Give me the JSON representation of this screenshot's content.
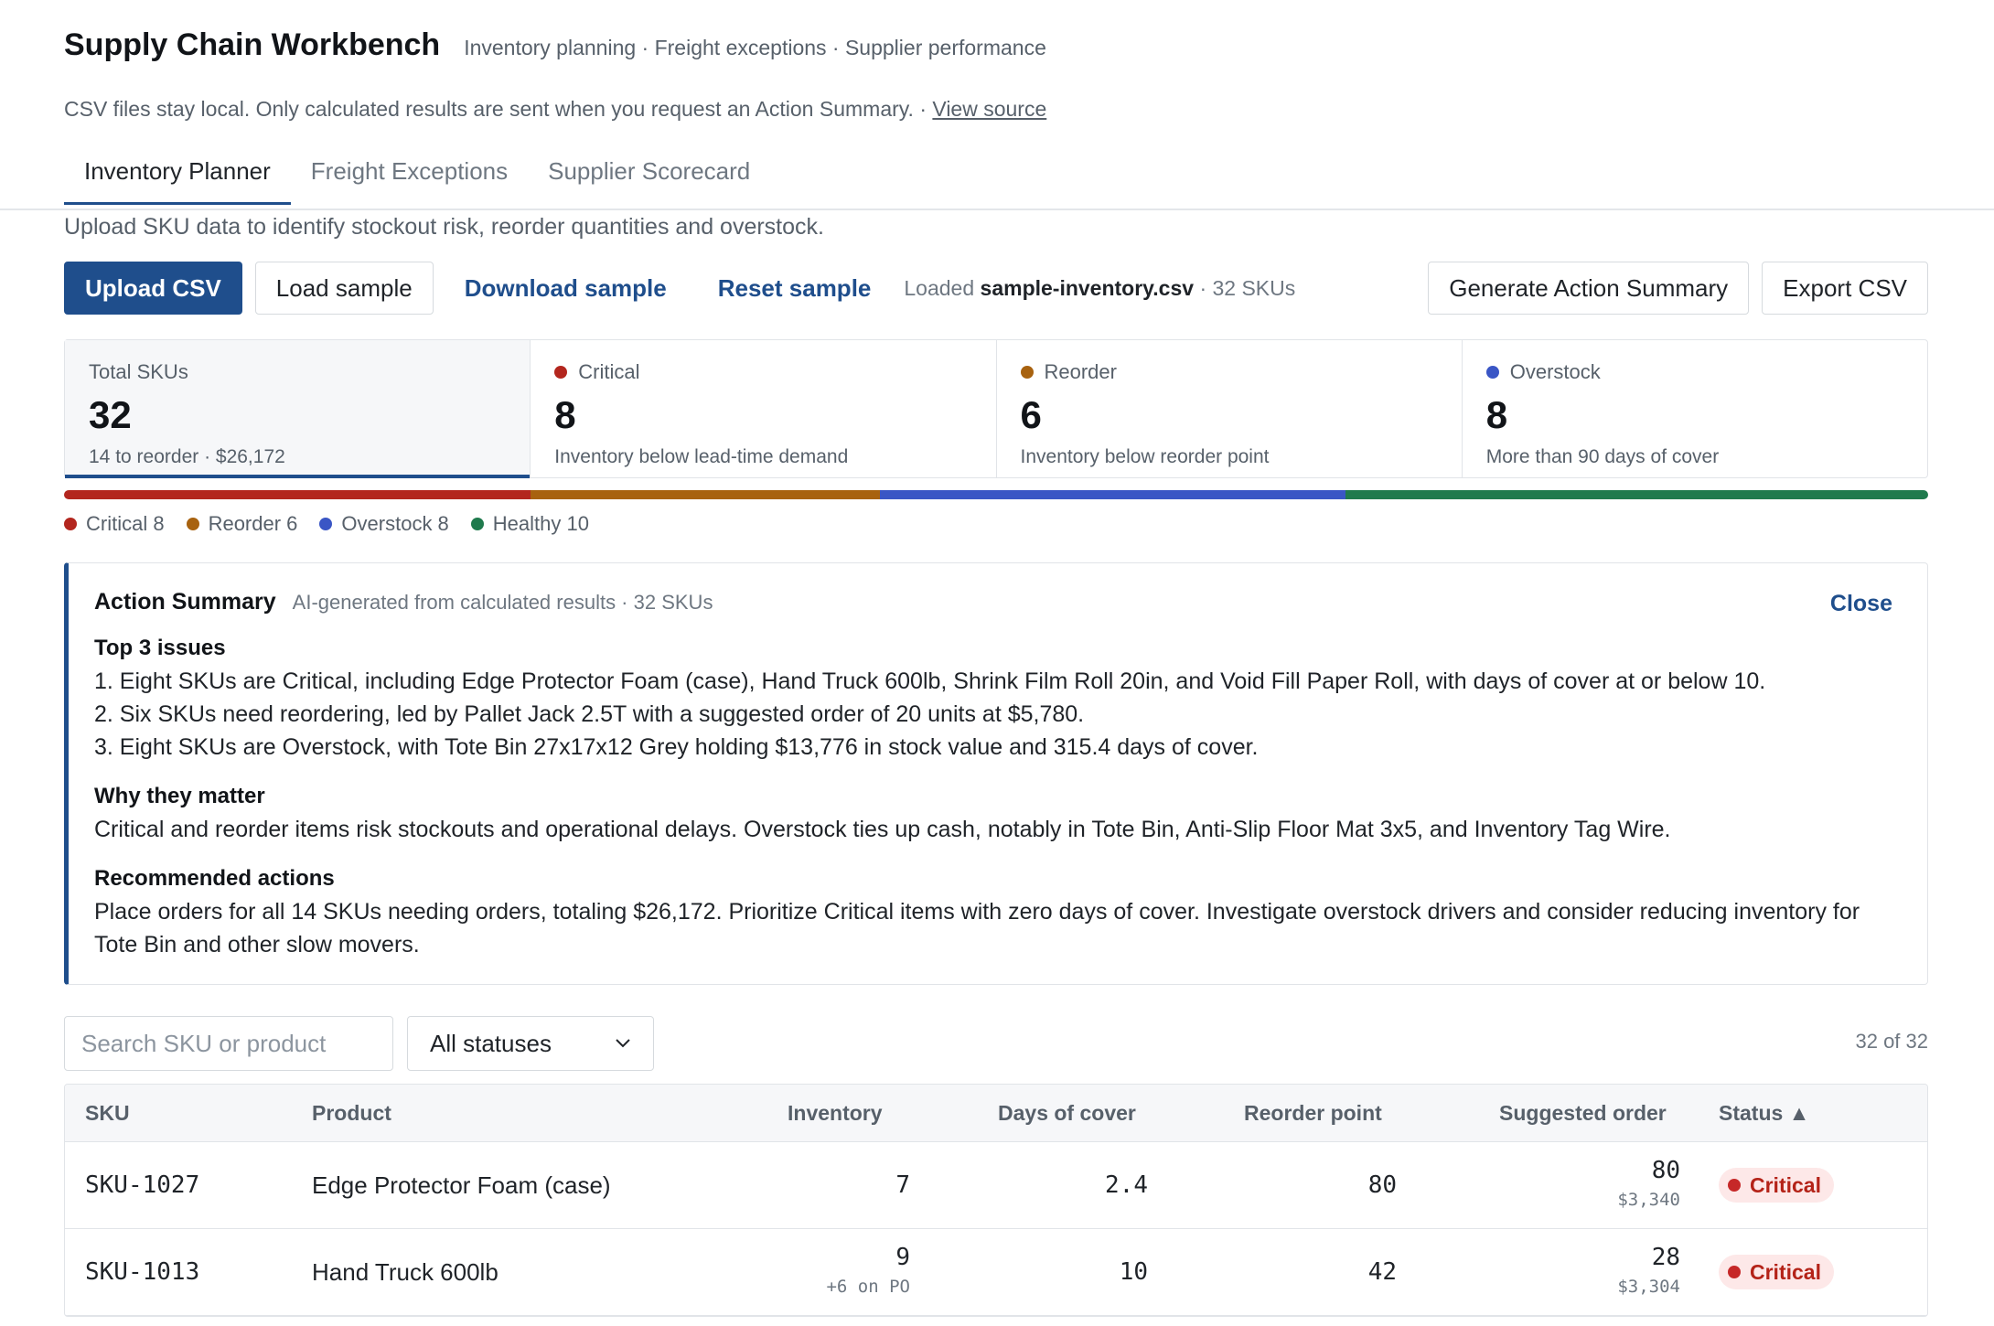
{
  "app": {
    "title": "Supply Chain Workbench",
    "subtitle": "Inventory planning · Freight exceptions · Supplier performance",
    "privacy_note": "CSV files stay local. Only calculated results are sent when you request an Action Summary. ·",
    "view_source": "View source"
  },
  "tabs": [
    {
      "label": "Inventory Planner",
      "active": true
    },
    {
      "label": "Freight Exceptions",
      "active": false
    },
    {
      "label": "Supplier Scorecard",
      "active": false
    }
  ],
  "intro": "Upload SKU data to identify stockout risk, reorder quantities and overstock.",
  "toolbar": {
    "upload": "Upload CSV",
    "load_sample": "Load sample",
    "download_sample": "Download sample",
    "reset_sample": "Reset sample",
    "loaded_prefix": "Loaded",
    "loaded_file": "sample-inventory.csv",
    "loaded_suffix": "· 32 SKUs",
    "generate": "Generate Action Summary",
    "export": "Export CSV"
  },
  "stats": [
    {
      "label": "Total SKUs",
      "value": "32",
      "desc": "14 to reorder · $26,172",
      "color": ""
    },
    {
      "label": "Critical",
      "value": "8",
      "desc": "Inventory below lead-time demand",
      "color": "#b3261e"
    },
    {
      "label": "Reorder",
      "value": "6",
      "desc": "Inventory below reorder point",
      "color": "#a8620f"
    },
    {
      "label": "Overstock",
      "value": "8",
      "desc": "More than 90 days of cover",
      "color": "#3a56c5"
    }
  ],
  "distribution": [
    {
      "label": "Critical 8",
      "count": 8,
      "color": "#b3261e"
    },
    {
      "label": "Reorder 6",
      "count": 6,
      "color": "#a8620f"
    },
    {
      "label": "Overstock 8",
      "count": 8,
      "color": "#3a56c5"
    },
    {
      "label": "Healthy 10",
      "count": 10,
      "color": "#1f7a4d"
    }
  ],
  "summary": {
    "title": "Action Summary",
    "meta": "AI-generated from calculated results · 32 SKUs",
    "close": "Close",
    "issues_heading": "Top 3 issues",
    "issue_1": "1. Eight SKUs are Critical, including Edge Protector Foam (case), Hand Truck 600lb, Shrink Film Roll 20in, and Void Fill Paper Roll, with days of cover at or below 10.",
    "issue_2": "2. Six SKUs need reordering, led by Pallet Jack 2.5T with a suggested order of 20 units at $5,780.",
    "issue_3": "3. Eight SKUs are Overstock, with Tote Bin 27x17x12 Grey holding $13,776 in stock value and 315.4 days of cover.",
    "why_heading": "Why they matter",
    "why_text": "Critical and reorder items risk stockouts and operational delays. Overstock ties up cash, notably in Tote Bin, Anti-Slip Floor Mat 3x5, and Inventory Tag Wire.",
    "actions_heading": "Recommended actions",
    "actions_text": "Place orders for all 14 SKUs needing orders, totaling $26,172. Prioritize Critical items with zero days of cover. Investigate overstock drivers and consider reducing inventory for Tote Bin and other slow movers."
  },
  "filters": {
    "search_placeholder": "Search SKU or product",
    "status_selected": "All statuses",
    "count": "32 of 32"
  },
  "table": {
    "headers": {
      "sku": "SKU",
      "product": "Product",
      "inventory": "Inventory",
      "days": "Days of cover",
      "reorder": "Reorder point",
      "suggested": "Suggested order",
      "status": "Status ▲"
    },
    "rows": [
      {
        "sku": "SKU-1027",
        "product": "Edge Protector Foam (case)",
        "inventory": "7",
        "inventory_sub": "",
        "days": "2.4",
        "reorder": "80",
        "suggested": "80",
        "suggested_cost": "$3,340",
        "status": "Critical"
      },
      {
        "sku": "SKU-1013",
        "product": "Hand Truck 600lb",
        "inventory": "9",
        "inventory_sub": "+6 on PO",
        "days": "10",
        "reorder": "42",
        "suggested": "28",
        "suggested_cost": "$3,304",
        "status": "Critical"
      }
    ]
  }
}
